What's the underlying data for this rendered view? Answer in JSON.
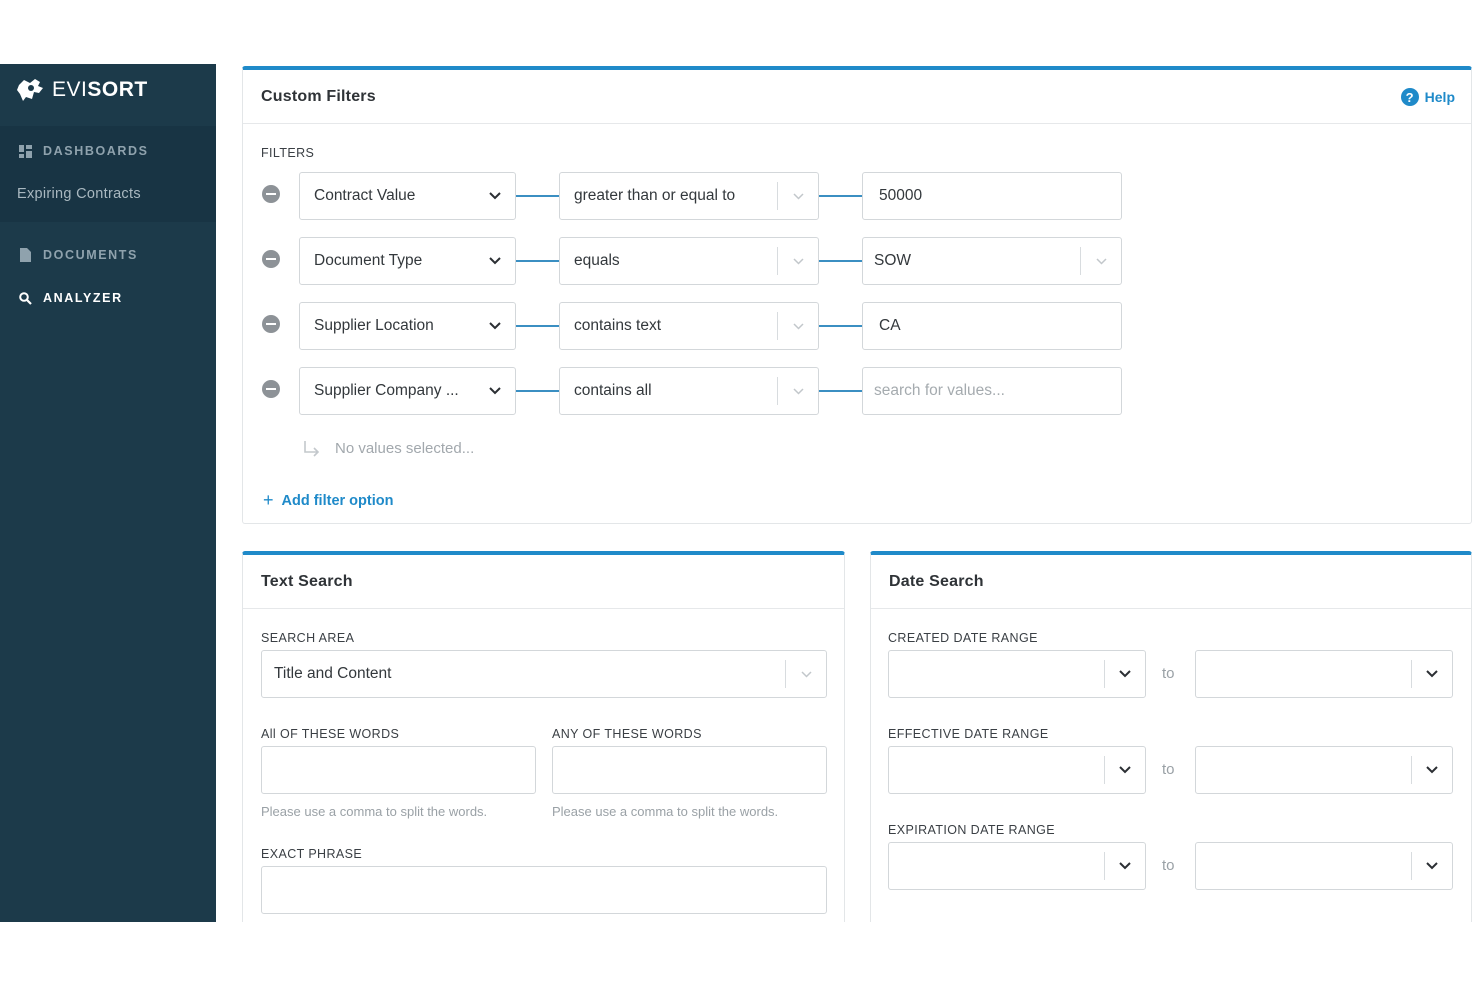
{
  "brand": {
    "name_light": "EVI",
    "name_bold": "SORT"
  },
  "sidebar": {
    "dashboards": "DASHBOARDS",
    "dashboard_sub": "Expiring Contracts",
    "documents": "DOCUMENTS",
    "analyzer": "ANALYZER"
  },
  "custom_filters": {
    "title": "Custom Filters",
    "help": "Help",
    "filters_label": "FILTERS",
    "rows": [
      {
        "field": "Contract Value",
        "operator": "greater than or equal to",
        "value": "50000"
      },
      {
        "field": "Document Type",
        "operator": "equals",
        "value": "SOW"
      },
      {
        "field": "Supplier Location",
        "operator": "contains text",
        "value": "CA"
      },
      {
        "field": "Supplier Company ...",
        "operator": "contains all",
        "value_placeholder": "search for values..."
      }
    ],
    "no_values": "No values selected...",
    "add_filter": "Add filter option"
  },
  "text_search": {
    "title": "Text Search",
    "search_area_label": "SEARCH AREA",
    "search_area_value": "Title and Content",
    "all_words_label": "All OF THESE WORDS",
    "any_words_label": "ANY OF THESE WORDS",
    "hint": "Please use a comma to split the words.",
    "exact_phrase_label": "EXACT PHRASE"
  },
  "date_search": {
    "title": "Date Search",
    "created_label": "CREATED DATE RANGE",
    "effective_label": "EFFECTIVE DATE RANGE",
    "expiration_label": "EXPIRATION DATE RANGE",
    "to": "to"
  },
  "colors": {
    "accent": "#1f8ac9",
    "sidebar": "#1c3a4a"
  }
}
